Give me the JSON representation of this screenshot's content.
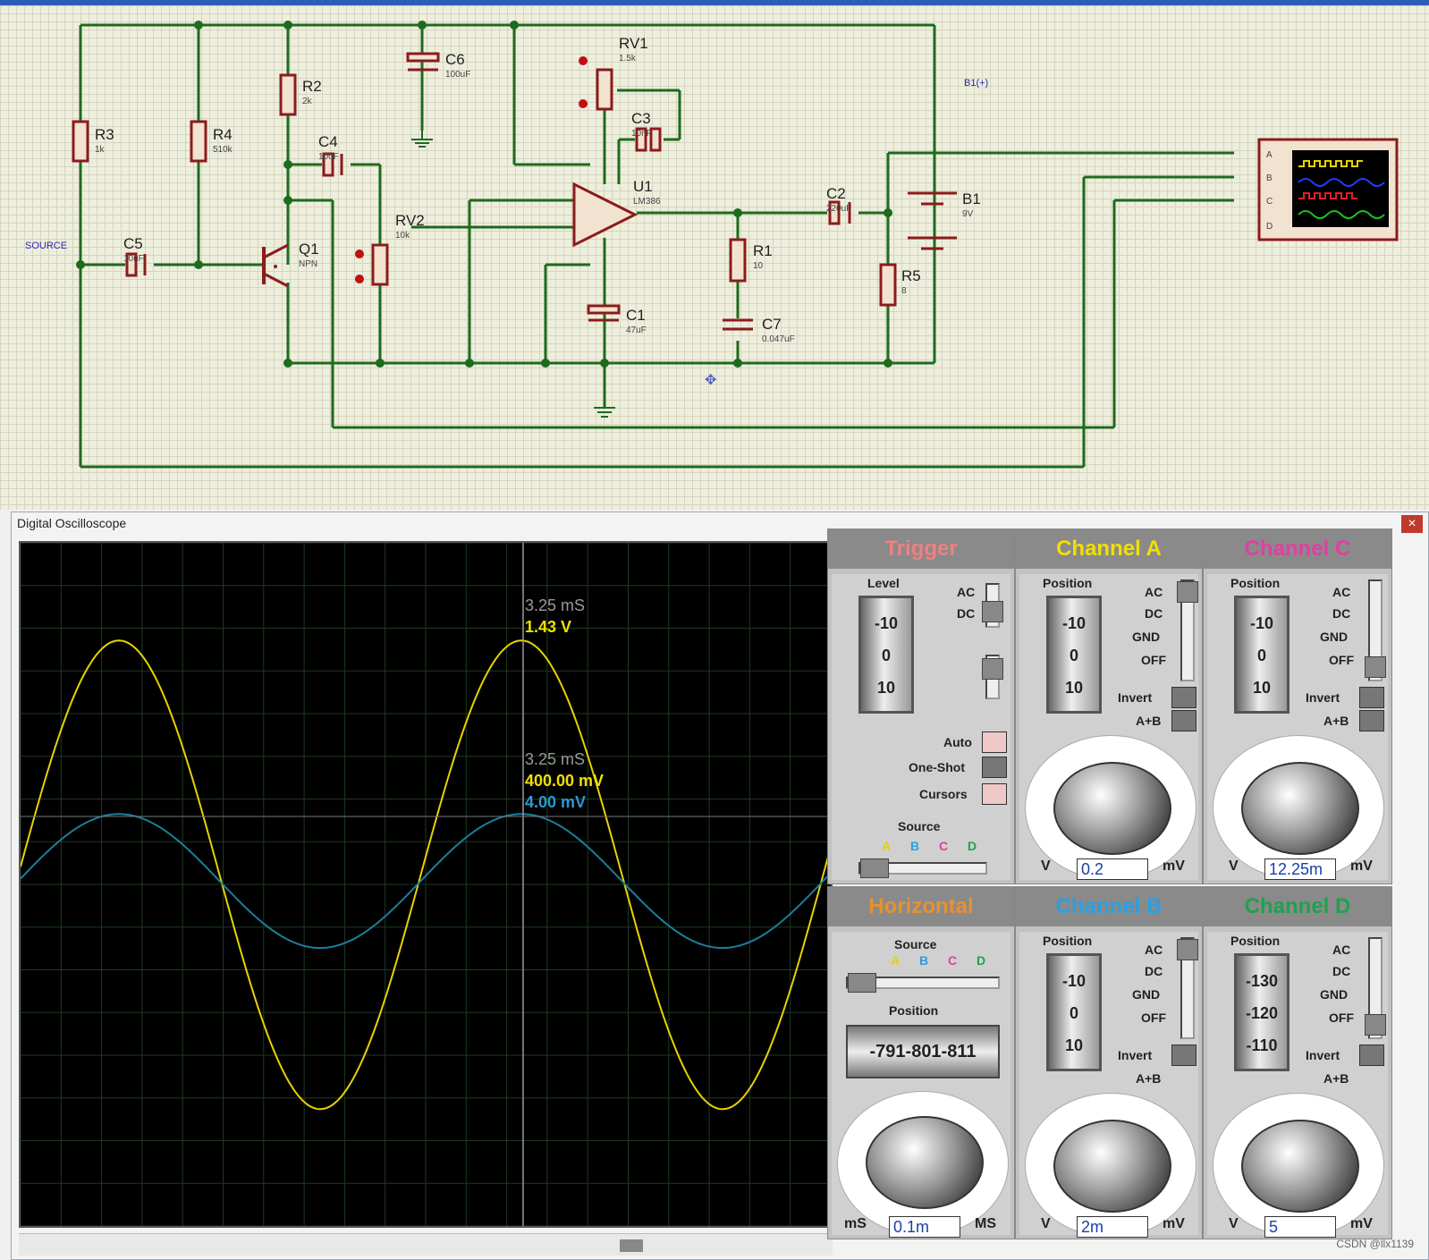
{
  "schematic": {
    "components": [
      {
        "ref": "R3",
        "value": "1k"
      },
      {
        "ref": "R4",
        "value": "510k"
      },
      {
        "ref": "R2",
        "value": "2k"
      },
      {
        "ref": "C6",
        "value": "100uF"
      },
      {
        "ref": "C4",
        "value": "10uF"
      },
      {
        "ref": "RV1",
        "value": "1.5k"
      },
      {
        "ref": "C3",
        "value": "10nF"
      },
      {
        "ref": "U1",
        "value": "LM386"
      },
      {
        "ref": "RV2",
        "value": "10k"
      },
      {
        "ref": "C5",
        "value": "10uF"
      },
      {
        "ref": "Q1",
        "value": "NPN"
      },
      {
        "ref": "C1",
        "value": "47uF"
      },
      {
        "ref": "R1",
        "value": "10"
      },
      {
        "ref": "C7",
        "value": "0.047uF"
      },
      {
        "ref": "C2",
        "value": "220uF"
      },
      {
        "ref": "B1",
        "value": "9V"
      },
      {
        "ref": "R5",
        "value": "8"
      }
    ],
    "probe_left": "SOURCE",
    "probe_right": "B1(+)"
  },
  "scope": {
    "title": "Digital Oscilloscope",
    "close_icon": "×",
    "cursor1": {
      "time": "3.25 mS",
      "value": "1.43 V"
    },
    "cursor2": {
      "time": "3.25 mS",
      "value_a": "400.00 mV",
      "value_b": "4.00 mV"
    },
    "traces": {
      "a": {
        "color": "#e6d300",
        "peak_frac": 0.143,
        "trough_frac": 0.829,
        "center_frac": 0.486
      },
      "b": {
        "color": "#1b7f9a",
        "peak_frac": 0.397,
        "trough_frac": 0.593,
        "center_frac": 0.495
      }
    }
  },
  "trigger": {
    "title": "Trigger",
    "level_label": "Level",
    "drum": [
      "-10",
      "0",
      "10"
    ],
    "ac": "AC",
    "dc": "DC",
    "auto": "Auto",
    "oneshot": "One-Shot",
    "cursors": "Cursors",
    "source_label": "Source",
    "sources": [
      "A",
      "B",
      "C",
      "D"
    ]
  },
  "horizontal": {
    "title": "Horizontal",
    "source_label": "Source",
    "sources": [
      "A",
      "B",
      "C",
      "D"
    ],
    "position_label": "Position",
    "position_drum": "-791-801-811",
    "readout": "0.1m",
    "unit_left": "mS",
    "unit_right": "MS"
  },
  "channel_a": {
    "title": "Channel A",
    "position_label": "Position",
    "drum": [
      "-10",
      "0",
      "10"
    ],
    "modes": [
      "AC",
      "DC",
      "GND",
      "OFF"
    ],
    "invert": "Invert",
    "aplusb": "A+B",
    "readout": "0.2",
    "unit_left": "V",
    "unit_right": "mV"
  },
  "channel_c": {
    "title": "Channel C",
    "position_label": "Position",
    "drum": [
      "-10",
      "0",
      "10"
    ],
    "modes": [
      "AC",
      "DC",
      "GND",
      "OFF"
    ],
    "invert": "Invert",
    "aplusb": "A+B",
    "readout": "12.25m",
    "unit_left": "V",
    "unit_right": "mV"
  },
  "channel_b": {
    "title": "Channel B",
    "position_label": "Position",
    "drum": [
      "-10",
      "0",
      "10"
    ],
    "modes": [
      "AC",
      "DC",
      "GND",
      "OFF"
    ],
    "invert": "Invert",
    "aplusb": "A+B",
    "readout": "2m",
    "unit_left": "V",
    "unit_right": "mV"
  },
  "channel_d": {
    "title": "Channel D",
    "position_label": "Position",
    "drum": [
      "-130",
      "-120",
      "-110"
    ],
    "modes": [
      "AC",
      "DC",
      "GND",
      "OFF"
    ],
    "invert": "Invert",
    "aplusb": "A+B",
    "readout": "5",
    "unit_left": "V",
    "unit_right": "mV"
  },
  "watermark": "CSDN @llx1139",
  "colors": {
    "a": "#f0e000",
    "b": "#2aa0e0",
    "c": "#e040a0",
    "d": "#20a050",
    "trigger": "#f08080",
    "horizontal": "#e89030"
  }
}
